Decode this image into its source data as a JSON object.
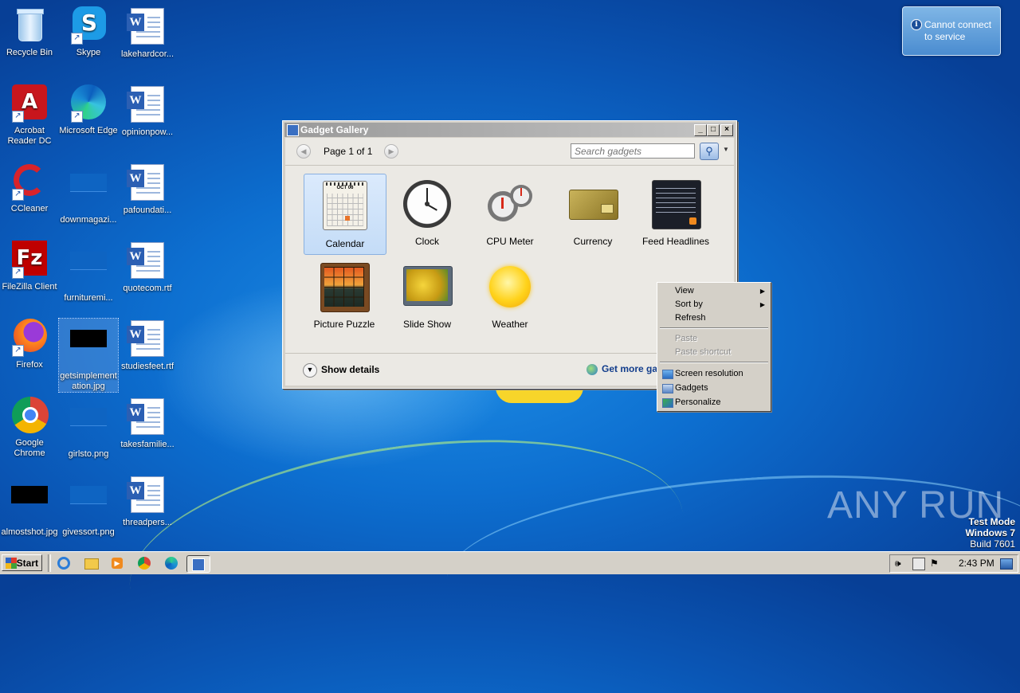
{
  "desktop": {
    "icons": [
      {
        "label": "Recycle Bin"
      },
      {
        "label": "Skype"
      },
      {
        "label": "lakehardcor..."
      },
      {
        "label": "Acrobat Reader DC"
      },
      {
        "label": "Microsoft Edge"
      },
      {
        "label": "opinionpow..."
      },
      {
        "label": "CCleaner"
      },
      {
        "label": "downmagazi..."
      },
      {
        "label": "pafoundati..."
      },
      {
        "label": "FileZilla Client"
      },
      {
        "label": "furnituremi..."
      },
      {
        "label": "quotecom.rtf"
      },
      {
        "label": "Firefox"
      },
      {
        "label": "getsimplementation.jpg"
      },
      {
        "label": "studiesfeet.rtf"
      },
      {
        "label": "Google Chrome"
      },
      {
        "label": "girlsto.png"
      },
      {
        "label": "takesfamilie..."
      },
      {
        "label": "almostshot.jpg"
      },
      {
        "label": "givessort.png"
      },
      {
        "label": "threadpers..."
      }
    ]
  },
  "notification": {
    "text": "Cannot connect to service"
  },
  "gadget_gallery": {
    "title": "Gadget Gallery",
    "page_label": "Page 1 of 1",
    "search_placeholder": "Search gadgets",
    "gadgets": [
      {
        "label": "Calendar"
      },
      {
        "label": "Clock"
      },
      {
        "label": "CPU Meter"
      },
      {
        "label": "Currency"
      },
      {
        "label": "Feed Headlines"
      },
      {
        "label": "Picture Puzzle"
      },
      {
        "label": "Slide Show"
      },
      {
        "label": "Weather"
      }
    ],
    "calendar_month": "OCT 06",
    "show_details": "Show details",
    "get_more": "Get more ga"
  },
  "context_menu": {
    "items": [
      {
        "label": "View"
      },
      {
        "label": "Sort by"
      },
      {
        "label": "Refresh"
      },
      {
        "label": "Paste"
      },
      {
        "label": "Paste shortcut"
      },
      {
        "label": "Screen resolution"
      },
      {
        "label": "Gadgets"
      },
      {
        "label": "Personalize"
      }
    ]
  },
  "watermark": {
    "brand": "ANY  RUN",
    "test_mode": "Test Mode",
    "os": "Windows 7",
    "build": "Build 7601"
  },
  "taskbar": {
    "start_label": "Start",
    "clock": "2:43 PM"
  }
}
